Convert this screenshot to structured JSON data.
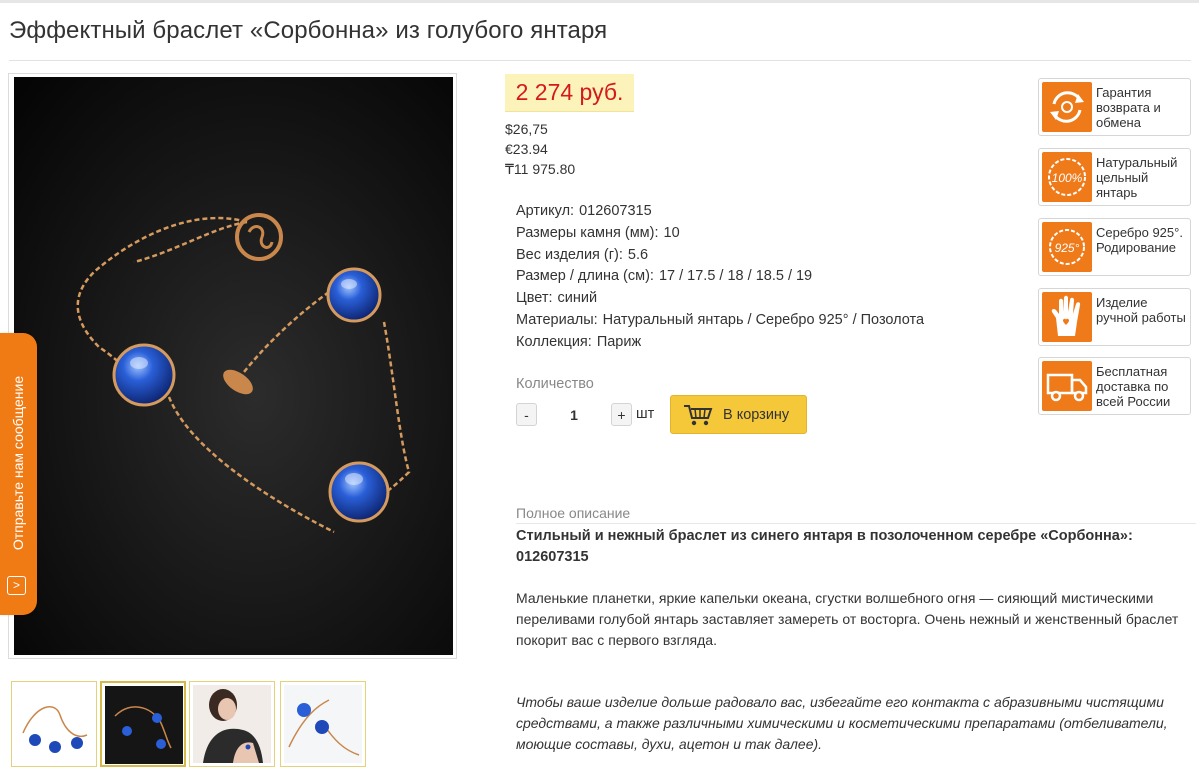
{
  "product": {
    "title": "Эффектный браслет «Сорбонна» из голубого янтаря",
    "price": "2 274 руб.",
    "price_usd": "$26,75",
    "price_eur": "€23.94",
    "price_kzt": "₸11 975.80"
  },
  "specs": [
    {
      "label": "Артикул:",
      "value": "012607315"
    },
    {
      "label": "Размеры камня (мм):",
      "value": "10"
    },
    {
      "label": "Вес изделия (г):",
      "value": "5.6"
    },
    {
      "label": "Размер / длина (см):",
      "value": "17 / 17.5 / 18 / 18.5 / 19"
    },
    {
      "label": "Цвет:",
      "value": "синий"
    },
    {
      "label": "Материалы:",
      "value": "Натуральный янтарь / Серебро 925° / Позолота"
    },
    {
      "label": "Коллекция:",
      "value": "Париж"
    }
  ],
  "quantity": {
    "label": "Количество",
    "minus": "-",
    "plus": "+",
    "value": "1",
    "unit": "шт"
  },
  "cart": {
    "label": "В корзину",
    "icon": "cart-icon"
  },
  "feedback": {
    "label": "Отправьте нам сообщение",
    "icon": "chevron-right-icon"
  },
  "description": {
    "heading": "Полное описание",
    "bold": "Стильный и нежный браслет из синего янтаря в позолоченном серебре «Сорбонна»: 012607315",
    "paragraph": "Маленькие планетки, яркие капельки океана, сгустки волшебного огня — сияющий мистическими переливами голубой янтарь заставляет замереть от восторга. Очень нежный и женственный браслет покорит вас с первого взгляда.",
    "care": "Чтобы ваше изделие дольше радовало вас, избегайте его контакта с абразивными чистящими средствами, а также различными химическими и косметическими препаратами (отбеливатели, моющие составы, духи, ацетон и так далее)."
  },
  "badges": [
    {
      "text": "Гарантия возврата и обмена",
      "icon": "return-guarantee-icon"
    },
    {
      "text": "Натуральный цельный янтарь",
      "icon": "natural-amber-100-icon",
      "icon_text": "100%"
    },
    {
      "text": "Серебро 925°. Родирование",
      "icon": "silver-925-icon",
      "icon_text": "925°"
    },
    {
      "text": "Изделие ручной работы",
      "icon": "handmade-hand-icon"
    },
    {
      "text": "Бесплатная доставка по всей России",
      "icon": "delivery-truck-icon"
    }
  ],
  "gallery": {
    "thumbnail_count": 4,
    "active_thumbnail": 2
  },
  "colors": {
    "accent_orange": "#f07b14",
    "price_red": "#d41a1a",
    "price_bg": "#fbf3ba",
    "cart_yellow": "#f5c83a"
  }
}
